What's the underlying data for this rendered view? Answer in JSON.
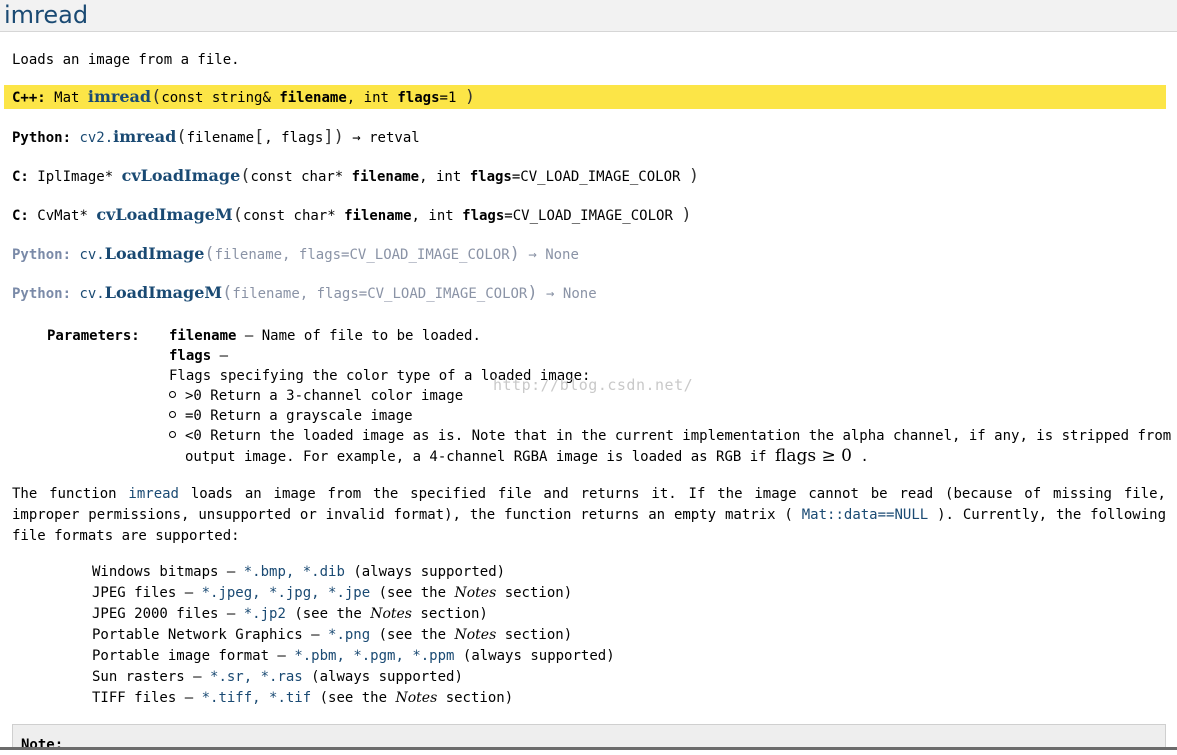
{
  "title": "imread",
  "summary": "Loads an image from a file.",
  "signatures": {
    "cpp": {
      "lang": "C++:",
      "ret": "Mat",
      "fn": "imread",
      "p1_type": "const string&",
      "p1_name": "filename",
      "sep": ",",
      "p2_type": "int",
      "p2_name": "flags",
      "p2_default": "=1"
    },
    "py": {
      "lang": "Python:",
      "mod": "cv2.",
      "fn": "imread",
      "p1": "filename",
      "opt_open": "[",
      "opt_sep": ",",
      "p2": "flags",
      "opt_close": "]",
      "arrow": "→",
      "ret": "retval"
    },
    "c1": {
      "lang": "C:",
      "ret": "IplImage*",
      "fn": "cvLoadImage",
      "p1_type": "const char*",
      "p1_name": "filename",
      "sep": ",",
      "p2_type": "int",
      "p2_name": "flags",
      "p2_default": "=CV_LOAD_IMAGE_COLOR"
    },
    "c2": {
      "lang": "C:",
      "ret": "CvMat*",
      "fn": "cvLoadImageM",
      "p1_type": "const char*",
      "p1_name": "filename",
      "sep": ",",
      "p2_type": "int",
      "p2_name": "flags",
      "p2_default": "=CV_LOAD_IMAGE_COLOR"
    },
    "py_old1": {
      "lang": "Python:",
      "mod": "cv.",
      "fn": "LoadImage",
      "args": "filename, flags=CV_LOAD_IMAGE_COLOR",
      "arrow": "→",
      "ret": "None"
    },
    "py_old2": {
      "lang": "Python:",
      "mod": "cv.",
      "fn": "LoadImageM",
      "args": "filename, flags=CV_LOAD_IMAGE_COLOR",
      "arrow": "→",
      "ret": "None"
    }
  },
  "parameters": {
    "label": "Parameters:",
    "filename_name": "filename",
    "dash": "–",
    "filename_desc": "Name of file to be loaded.",
    "flags_name": "flags",
    "flags_desc": "Flags specifying the color type of a loaded image:",
    "bullets": [
      {
        "key": ">0",
        "text": "Return a 3-channel color image"
      },
      {
        "key": "=0",
        "text": "Return a grayscale image"
      },
      {
        "key": "<0",
        "text": "Return the loaded image as is. Note that in the current implementation the alpha channel, if any, is stripped from the"
      }
    ],
    "bullet3_cont": "output image. For example, a 4-channel RGBA image is loaded as RGB if",
    "bullet3_math": "flags ≥ 0",
    "bullet3_end": "."
  },
  "description": {
    "part1": "The function",
    "code1": "imread",
    "part2": "loads an image from the specified file and returns it. If the image cannot be read (because of missing file, improper permissions, unsupported or invalid format), the function returns an empty matrix (",
    "code2": "Mat::data==NULL",
    "part3": "). Currently, the following file formats are supported:"
  },
  "formats": [
    {
      "name": "Windows bitmaps –",
      "exts": "*.bmp, *.dib",
      "note_pre": "(always supported)",
      "note_it": "",
      "note_post": ""
    },
    {
      "name": "JPEG files –",
      "exts": "*.jpeg, *.jpg, *.jpe",
      "note_pre": "(see the",
      "note_it": "Notes",
      "note_post": "section)"
    },
    {
      "name": "JPEG 2000 files –",
      "exts": "*.jp2",
      "note_pre": "(see the",
      "note_it": "Notes",
      "note_post": "section)"
    },
    {
      "name": "Portable Network Graphics –",
      "exts": "*.png",
      "note_pre": "(see the",
      "note_it": "Notes",
      "note_post": "section)"
    },
    {
      "name": "Portable image format –",
      "exts": "*.pbm, *.pgm, *.ppm",
      "note_pre": "(always supported)",
      "note_it": "",
      "note_post": ""
    },
    {
      "name": "Sun rasters –",
      "exts": "*.sr, *.ras",
      "note_pre": "(always supported)",
      "note_it": "",
      "note_post": ""
    },
    {
      "name": "TIFF files –",
      "exts": "*.tiff, *.tif",
      "note_pre": "(see the",
      "note_it": "Notes",
      "note_post": "section)"
    }
  ],
  "watermark": "http://blog.csdn.net/",
  "note_label": "Note:",
  "colors": {
    "highlight": "#fce547",
    "link": "#1a4a73",
    "dim": "#8a93a6"
  }
}
